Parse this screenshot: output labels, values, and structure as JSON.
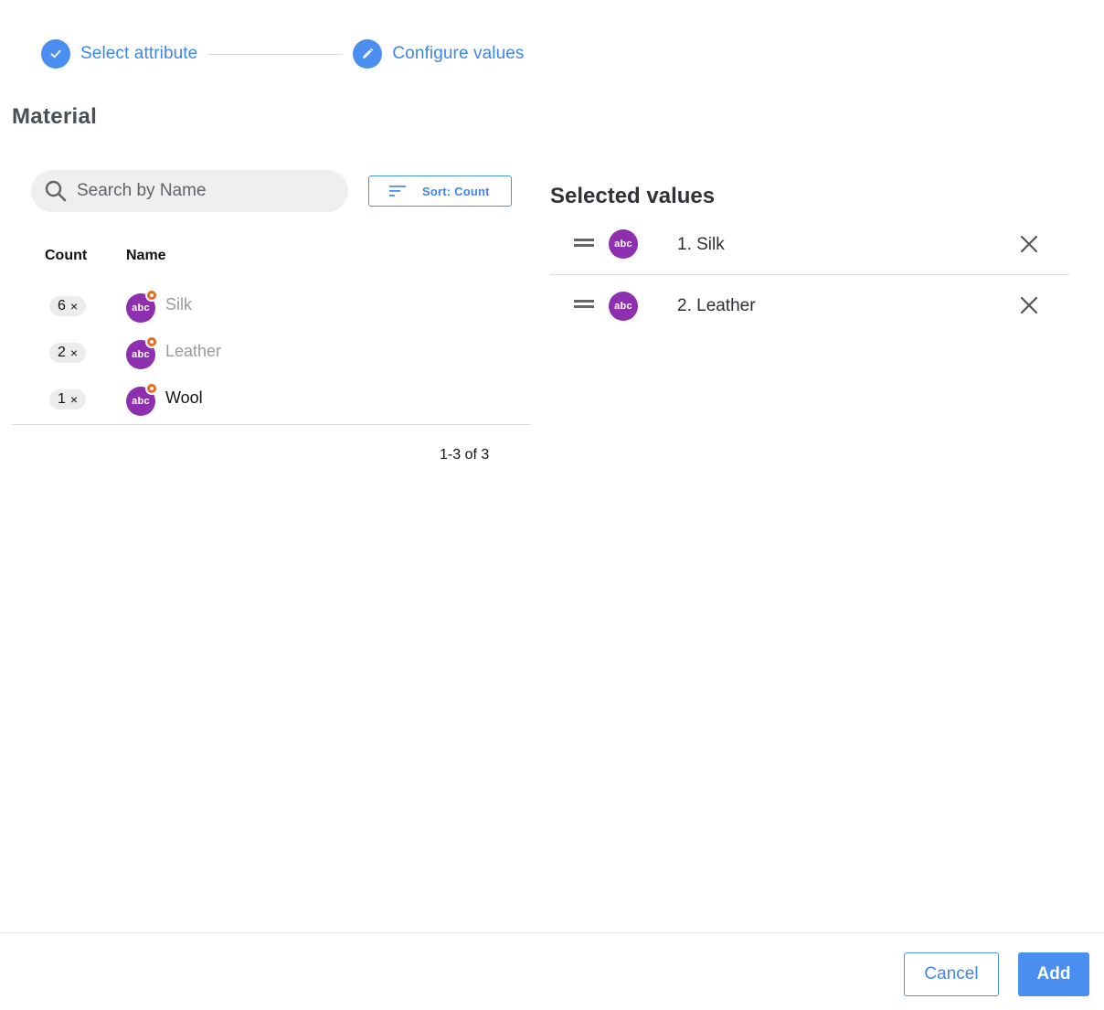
{
  "stepper": {
    "steps": [
      {
        "label": "Select attribute",
        "icon": "check-icon",
        "state": "completed"
      },
      {
        "label": "Configure values",
        "icon": "pencil-icon",
        "state": "active"
      }
    ]
  },
  "attribute": {
    "title": "Material"
  },
  "search": {
    "placeholder": "Search by Name",
    "value": ""
  },
  "sort": {
    "label": "Sort: Count",
    "icon": "sort-icon"
  },
  "table": {
    "headers": {
      "count": "Count",
      "name": "Name"
    },
    "rows": [
      {
        "count": "6",
        "count_suffix": "×",
        "name": "Silk",
        "selected": true,
        "avatar_text": "abc"
      },
      {
        "count": "2",
        "count_suffix": "×",
        "name": "Leather",
        "selected": true,
        "avatar_text": "abc"
      },
      {
        "count": "1",
        "count_suffix": "×",
        "name": "Wool",
        "selected": false,
        "avatar_text": "abc"
      }
    ],
    "pagination": "1-3 of 3"
  },
  "selected": {
    "title": "Selected values",
    "items": [
      {
        "label": "1. Silk",
        "avatar_text": "abc"
      },
      {
        "label": "2. Leather",
        "avatar_text": "abc"
      }
    ]
  },
  "footer": {
    "cancel_label": "Cancel",
    "add_label": "Add"
  },
  "colors": {
    "accent": "#4a8ff0",
    "avatar": "#8e2fb0",
    "badge": "#ea6a1f",
    "muted_text": "#9b9b9b",
    "text": "#111111"
  }
}
